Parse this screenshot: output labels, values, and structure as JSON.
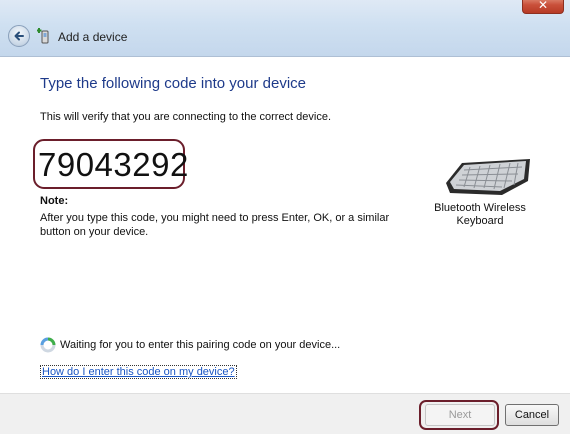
{
  "window": {
    "title": "Add a device",
    "close_glyph": "✕"
  },
  "main": {
    "heading": "Type the following code into your device",
    "subtext": "This will verify that you are connecting to the correct device.",
    "pairing_code": "79043292",
    "note_label": "Note:",
    "note_text": "After you type this code, you might need to press Enter, OK, or a similar button on your device.",
    "device_name": "Bluetooth Wireless Keyboard",
    "status_text": "Waiting for you to enter this pairing code on your device...",
    "help_link": "How do I enter this code on my device?"
  },
  "footer": {
    "next_label": "Next",
    "cancel_label": "Cancel"
  },
  "icons": {
    "back": "back-arrow-icon",
    "device": "add-device-icon",
    "keyboard": "keyboard-icon",
    "spinner": "waiting-spinner-icon"
  },
  "colors": {
    "heading": "#1e3a8a",
    "link": "#1a56c4",
    "highlight": "#6b1e2b"
  }
}
